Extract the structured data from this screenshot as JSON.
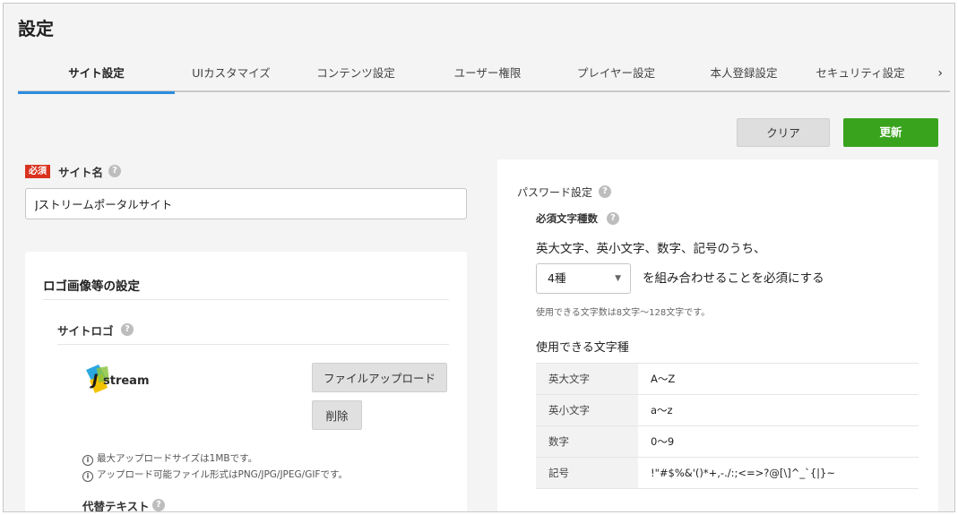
{
  "page_title": "設定",
  "tabs": [
    {
      "label": "サイト設定",
      "active": true
    },
    {
      "label": "UIカスタマイズ",
      "active": false
    },
    {
      "label": "コンテンツ設定",
      "active": false
    },
    {
      "label": "ユーザー権限",
      "active": false
    },
    {
      "label": "プレイヤー設定",
      "active": false
    },
    {
      "label": "本人登録設定",
      "active": false
    },
    {
      "label": "セキュリティ設定",
      "active": false
    }
  ],
  "tabs_next_glyph": "›",
  "actions": {
    "clear_label": "クリア",
    "update_label": "更新"
  },
  "site_name": {
    "required_badge": "必須",
    "label": "サイト名",
    "value": "Jストリームポータルサイト"
  },
  "help_glyph": "?",
  "logo_settings": {
    "title": "ロゴ画像等の設定",
    "site_logo_label": "サイトロゴ",
    "logo_text": "stream",
    "upload_label": "ファイルアップロード",
    "delete_label": "削除",
    "notes": [
      "最大アップロードサイズは1MBです。",
      "アップロード可能ファイル形式はPNG/JPG/JPEG/GIFです。"
    ],
    "alt_text_label": "代替テキスト"
  },
  "password": {
    "title": "パスワード設定",
    "required_kinds_label": "必須文字種数",
    "sentence_1": "英大文字、英小文字、数字、記号のうち、",
    "selected_kinds": "4種",
    "sentence_2": "を組み合わせることを必須にする",
    "hint": "使用できる文字数は8文字〜128文字です。",
    "usable_kinds_title": "使用できる文字種",
    "kinds": [
      {
        "name": "英大文字",
        "chars": "A〜Z"
      },
      {
        "name": "英小文字",
        "chars": "a〜z"
      },
      {
        "name": "数字",
        "chars": "0〜9"
      },
      {
        "name": "記号",
        "chars": "!\"#$%&'()*+,-./:;<=>?@[\\]^_`{|}~"
      }
    ]
  },
  "colors": {
    "accent": "#2d8ce0",
    "update": "#3aa31e",
    "required": "#d9321f"
  }
}
